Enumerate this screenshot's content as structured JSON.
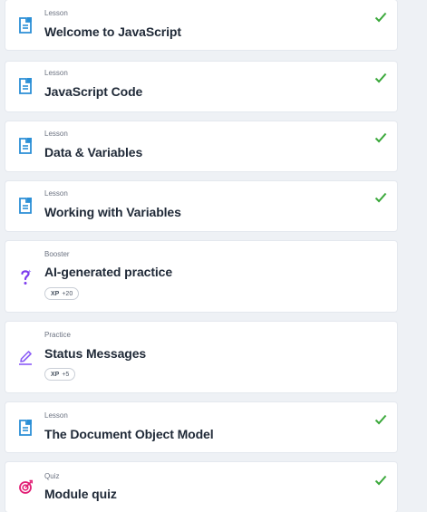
{
  "items": [
    {
      "kind": "Lesson",
      "title": "Welcome to JavaScript",
      "icon": "lesson-doc-icon",
      "completed": true
    },
    {
      "kind": "Lesson",
      "title": "JavaScript Code",
      "icon": "lesson-doc-icon",
      "completed": true
    },
    {
      "kind": "Lesson",
      "title": "Data & Variables",
      "icon": "lesson-doc-icon",
      "completed": true
    },
    {
      "kind": "Lesson",
      "title": "Working with Variables",
      "icon": "lesson-doc-icon",
      "completed": true
    },
    {
      "kind": "Booster",
      "title": "AI-generated practice",
      "icon": "question-mark-icon",
      "completed": false,
      "xp_label": "XP",
      "xp_value": "+20"
    },
    {
      "kind": "Practice",
      "title": "Status Messages",
      "icon": "pencil-icon",
      "completed": false,
      "xp_label": "XP",
      "xp_value": "+5"
    },
    {
      "kind": "Lesson",
      "title": "The Document Object Model",
      "icon": "lesson-doc-icon",
      "completed": true
    },
    {
      "kind": "Quiz",
      "title": "Module quiz",
      "icon": "target-icon",
      "completed": true
    }
  ],
  "colors": {
    "lesson_icon": "#2b8fd6",
    "booster_icon": "#7c3aed",
    "practice_icon": "#8b5cf6",
    "quiz_icon": "#e11d74",
    "check": "#3aa83a"
  }
}
